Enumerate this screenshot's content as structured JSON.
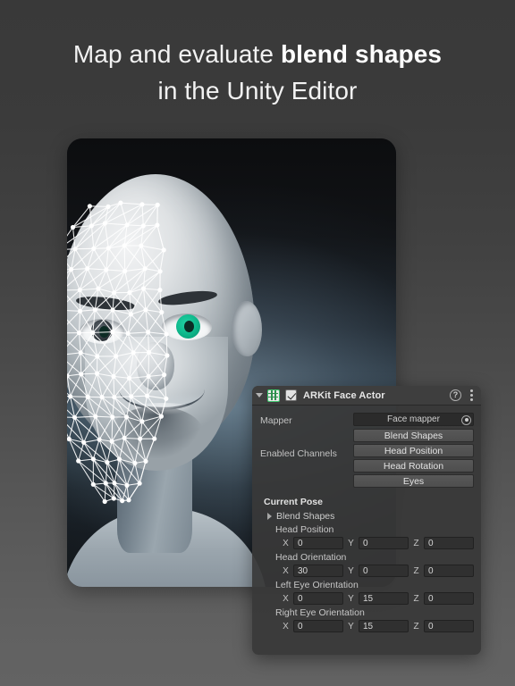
{
  "headline": {
    "line1_prefix": "Map and evaluate ",
    "line1_strong": "blend shapes",
    "line2": "in the Unity Editor"
  },
  "inspector": {
    "title": "ARKit Face Actor",
    "enabled": true,
    "icons": {
      "foldout": "foldout-triangle-icon",
      "script": "script-component-icon",
      "help": "?",
      "menu": "kebab-menu-icon"
    },
    "mapper": {
      "label": "Mapper",
      "value": "Face mapper"
    },
    "enabled_channels": {
      "label": "Enabled Channels",
      "buttons": [
        "Blend Shapes",
        "Head Position",
        "Head Rotation",
        "Eyes"
      ]
    },
    "current_pose": {
      "title": "Current Pose",
      "blend_shapes_foldout": "Blend Shapes",
      "vectors": [
        {
          "label": "Head Position",
          "axes": [
            "X",
            "Y",
            "Z"
          ],
          "values": [
            "0",
            "0",
            "0"
          ]
        },
        {
          "label": "Head Orientation",
          "axes": [
            "X",
            "Y",
            "Z"
          ],
          "values": [
            "30",
            "0",
            "0"
          ]
        },
        {
          "label": "Left Eye Orientation",
          "axes": [
            "X",
            "Y",
            "Z"
          ],
          "values": [
            "0",
            "15",
            "0"
          ]
        },
        {
          "label": "Right Eye Orientation",
          "axes": [
            "X",
            "Y",
            "Z"
          ],
          "values": [
            "0",
            "15",
            "0"
          ]
        }
      ]
    }
  },
  "viewport": {
    "subject": "3d-head-model",
    "overlay": "face-tracking-wireframe-mesh",
    "eye_color": "#12bd90"
  }
}
